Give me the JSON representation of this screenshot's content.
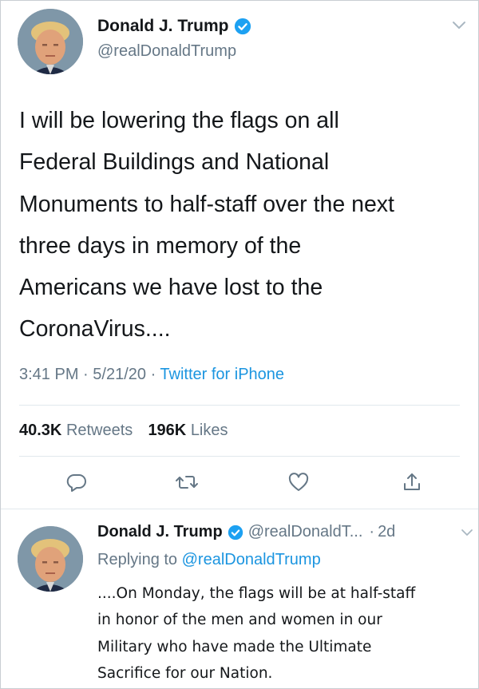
{
  "main_tweet": {
    "author_name": "Donald J. Trump",
    "handle": "@realDonaldTrump",
    "text_lines": [
      "I will be lowering the flags on all",
      "Federal Buildings and National",
      "Monuments to half-staff over the next",
      "three days in memory of the",
      "Americans we have lost to the",
      "CoronaVirus...."
    ],
    "time": "3:41 PM",
    "date": "5/21/20",
    "source": "Twitter for iPhone",
    "retweets_count": "40.3K",
    "retweets_label": "Retweets",
    "likes_count": "196K",
    "likes_label": "Likes"
  },
  "reply_tweet": {
    "author_name": "Donald J. Trump",
    "handle_truncated": "@realDonaldT...",
    "age": "2d",
    "replying_prefix": "Replying to",
    "replying_handle": "@realDonaldTrump",
    "text_lines": [
      "....On Monday, the flags will be at half-staff",
      "in honor of the men and women in our",
      "Military who have made the Ultimate",
      "Sacrifice for our Nation."
    ]
  },
  "icons": {
    "verified": "verified-badge-icon",
    "chevron": "chevron-down-icon",
    "reply": "reply-icon",
    "retweet": "retweet-icon",
    "like": "heart-icon",
    "share": "share-icon"
  },
  "colors": {
    "text": "#14171a",
    "secondary": "#657786",
    "link": "#1b95e0",
    "verified": "#1da1f2",
    "divider": "#e1e8ed"
  }
}
